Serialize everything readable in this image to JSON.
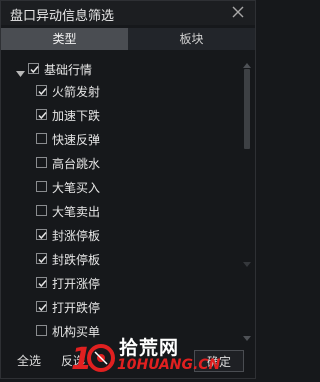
{
  "window": {
    "title": "盘口异动信息筛选"
  },
  "tabs": [
    {
      "label": "类型",
      "active": true
    },
    {
      "label": "板块",
      "active": false
    }
  ],
  "tree": {
    "group_label": "基础行情",
    "group_checked": true,
    "items": [
      {
        "label": "火箭发射",
        "checked": true
      },
      {
        "label": "加速下跌",
        "checked": true
      },
      {
        "label": "快速反弹",
        "checked": false
      },
      {
        "label": "高台跳水",
        "checked": false
      },
      {
        "label": "大笔买入",
        "checked": false
      },
      {
        "label": "大笔卖出",
        "checked": false
      },
      {
        "label": "封涨停板",
        "checked": true
      },
      {
        "label": "封跌停板",
        "checked": true
      },
      {
        "label": "打开涨停",
        "checked": true
      },
      {
        "label": "打开跌停",
        "checked": true
      },
      {
        "label": "机构买单",
        "checked": false
      }
    ]
  },
  "footer": {
    "select_all_label": "全选",
    "invert_label": "反选",
    "confirm_label": "确定"
  },
  "watermark": {
    "text": "拾荒网",
    "domain": "10HUANG.CN"
  },
  "colors": {
    "background": "#16181b",
    "active_tab": "#4a4d52",
    "check": "#e6e6e6",
    "watermark_red": "#e02020"
  }
}
